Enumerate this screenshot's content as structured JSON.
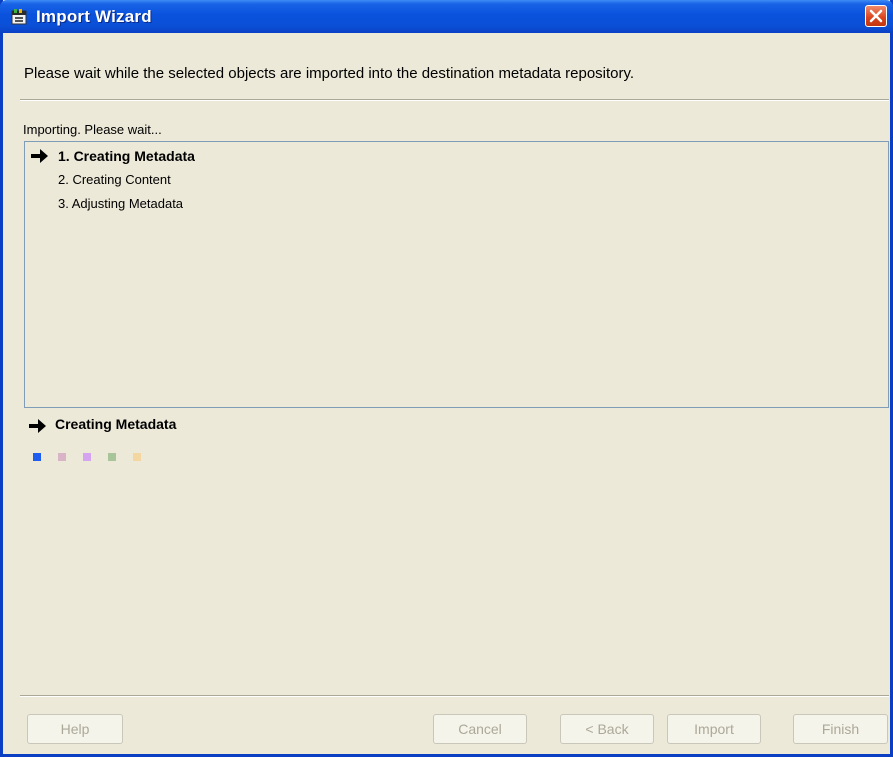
{
  "window": {
    "title": "Import Wizard",
    "app_icon": "import-wizard-icon",
    "close_icon": "close-icon",
    "titlebar_color": "#0a52dd",
    "close_color": "#d9421c"
  },
  "instruction": "Please wait while the selected objects are imported into the destination metadata repository.",
  "status": "Importing.  Please wait...",
  "steps": [
    {
      "label": "1. Creating Metadata",
      "active": true
    },
    {
      "label": "2. Creating Content",
      "active": false
    },
    {
      "label": "3. Adjusting Metadata",
      "active": false
    }
  ],
  "current_step": "Creating Metadata",
  "arrow_icon": "right-arrow-icon",
  "progress_indicator": {
    "colors": [
      "#1f5cf0",
      "#d8b4c6",
      "#d4a4f0",
      "#a8c49a",
      "#f4d6a0"
    ],
    "active_index": 0
  },
  "buttons": {
    "help": "Help",
    "cancel": "Cancel",
    "back": "< Back",
    "import": "Import",
    "finish": "Finish"
  }
}
